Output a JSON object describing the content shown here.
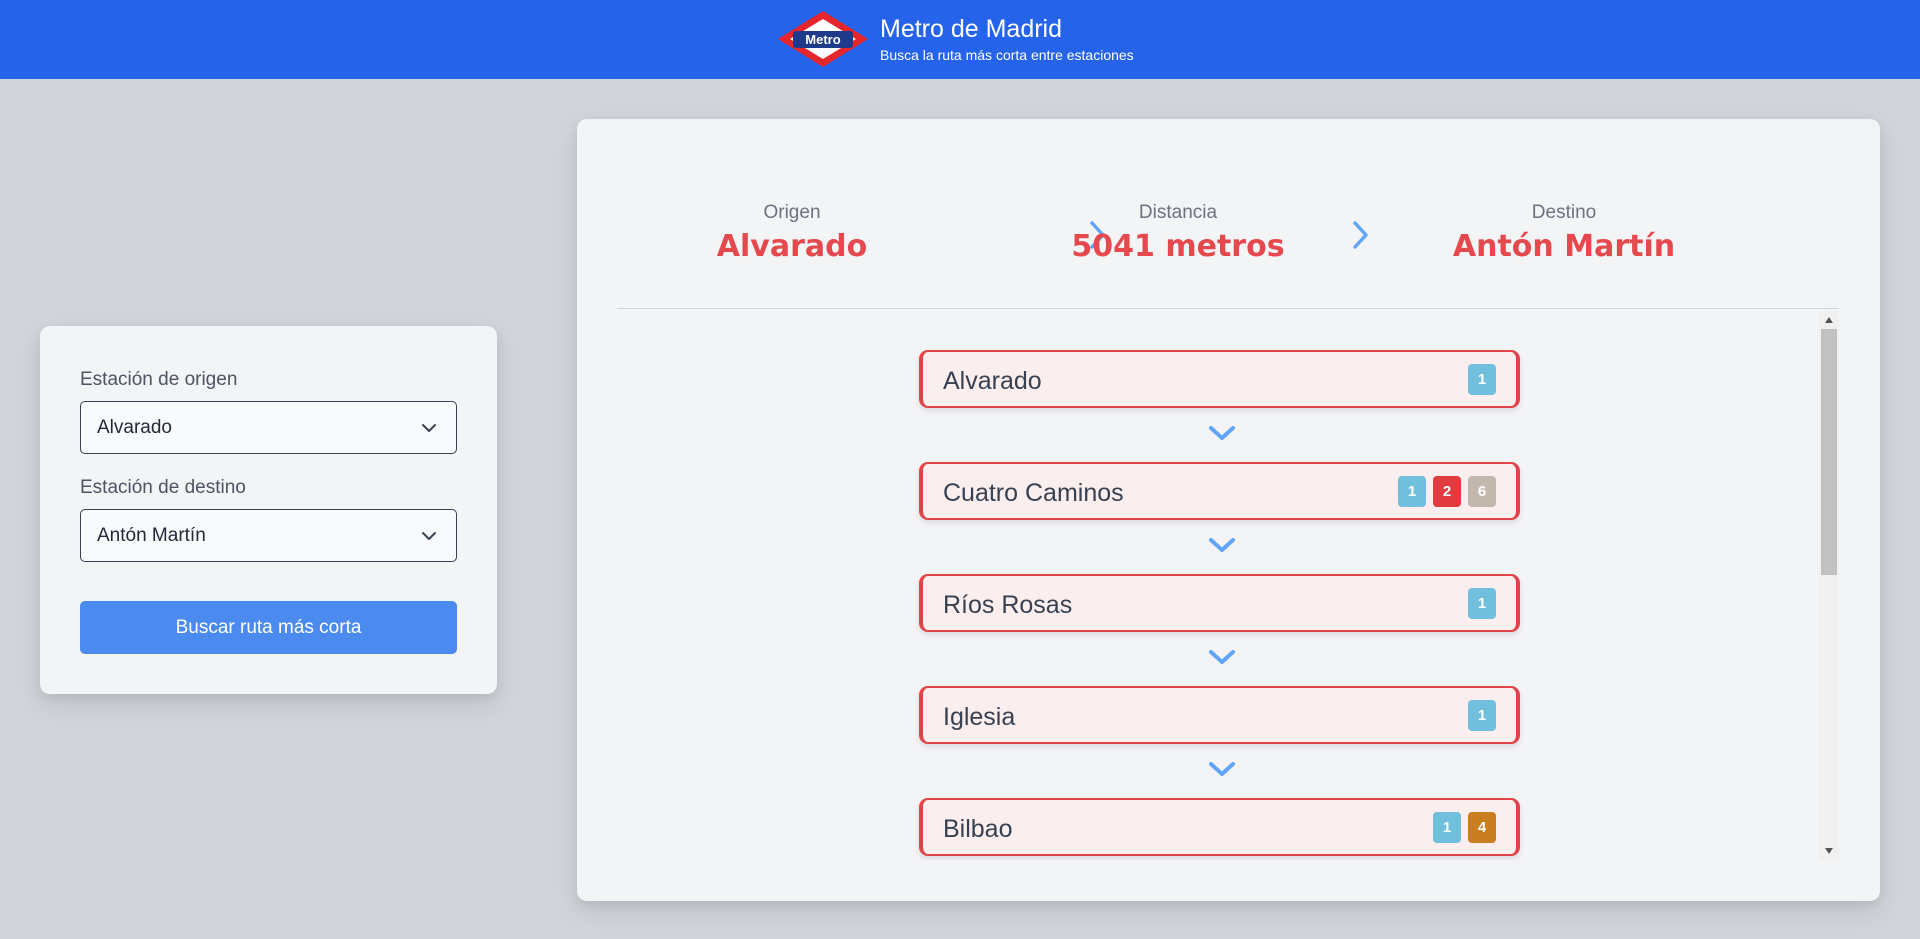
{
  "app": {
    "title": "Metro de Madrid",
    "subtitle": "Busca la ruta más corta entre estaciones",
    "logo_text": "Metro"
  },
  "form": {
    "origin_label": "Estación de origen",
    "origin_value": "Alvarado",
    "destination_label": "Estación de destino",
    "destination_value": "Antón Martín",
    "search_button": "Buscar ruta más corta"
  },
  "summary": {
    "origin_label": "Origen",
    "origin_value": "Alvarado",
    "distance_label": "Distancia",
    "distance_value": "5041 metros",
    "destination_label": "Destino",
    "destination_value": "Antón Martín"
  },
  "route": [
    {
      "name": "Alvarado",
      "lines": [
        {
          "n": "1",
          "color": "#6fbfdd"
        }
      ]
    },
    {
      "name": "Cuatro Caminos",
      "lines": [
        {
          "n": "1",
          "color": "#6fbfdd"
        },
        {
          "n": "2",
          "color": "#e23b3f"
        },
        {
          "n": "6",
          "color": "#c2b8ad"
        }
      ]
    },
    {
      "name": "Ríos Rosas",
      "lines": [
        {
          "n": "1",
          "color": "#6fbfdd"
        }
      ]
    },
    {
      "name": "Iglesia",
      "lines": [
        {
          "n": "1",
          "color": "#6fbfdd"
        }
      ]
    },
    {
      "name": "Bilbao",
      "lines": [
        {
          "n": "1",
          "color": "#6fbfdd"
        },
        {
          "n": "4",
          "color": "#c97e1f"
        }
      ]
    }
  ],
  "colors": {
    "header": "#2563eb",
    "accent_red": "#e5484d",
    "button_blue": "#4b8bf0",
    "arrow_blue": "#60a5fa"
  }
}
